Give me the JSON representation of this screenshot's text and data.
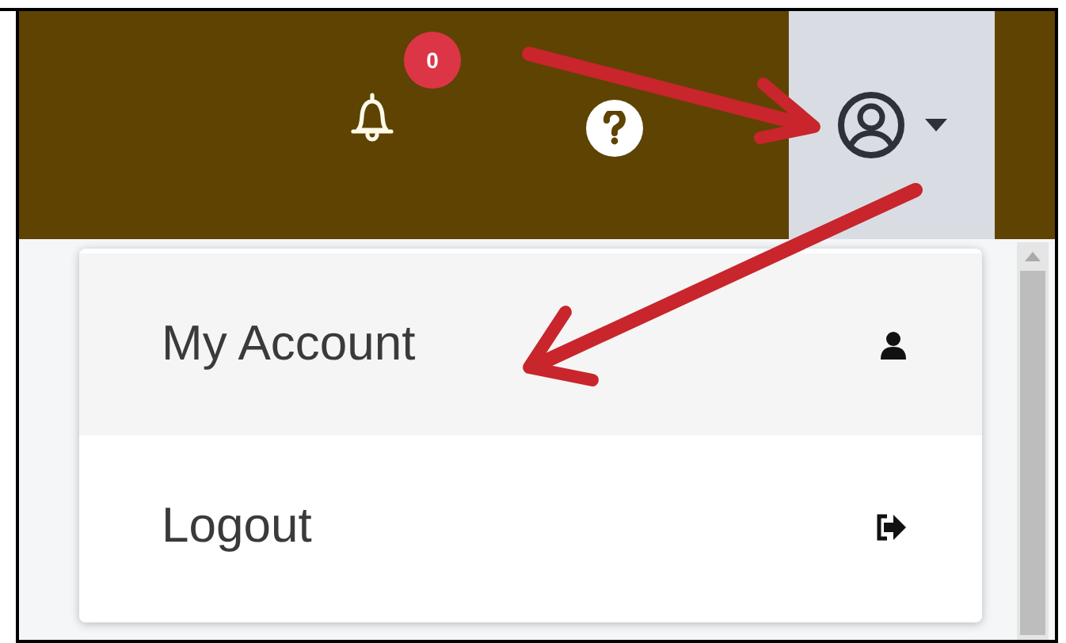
{
  "header": {
    "notification_badge": "0"
  },
  "user_menu": {
    "expanded": true,
    "items": [
      {
        "label": "My Account",
        "kind": "account",
        "selected": true
      },
      {
        "label": "Logout",
        "kind": "logout",
        "selected": false
      }
    ]
  }
}
